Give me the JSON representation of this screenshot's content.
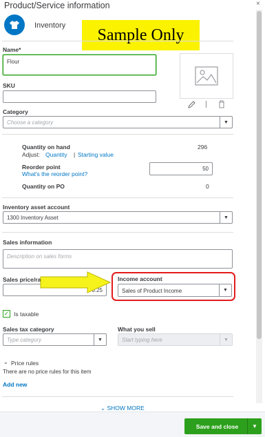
{
  "header": {
    "title": "Product/Service information",
    "close": "×",
    "type_label": "Inventory"
  },
  "banner": {
    "text": "Sample Only"
  },
  "name": {
    "label": "Name*",
    "value": "Flour"
  },
  "sku": {
    "label": "SKU",
    "value": ""
  },
  "category": {
    "label": "Category",
    "placeholder": "Choose a category"
  },
  "quantity_on_hand": {
    "label": "Quantity on hand",
    "value": "296",
    "adjust_prefix": "Adjust:",
    "adjust_quantity": "Quantity",
    "separator": "|",
    "starting_value": "Starting value"
  },
  "reorder_point": {
    "label": "Reorder point",
    "help_link": "What's the reorder point?",
    "value": "50"
  },
  "quantity_on_po": {
    "label": "Quantity on PO",
    "value": "0"
  },
  "inventory_asset_account": {
    "label": "Inventory asset account",
    "value": "1300 Inventory Asset"
  },
  "sales_information": {
    "label": "Sales information",
    "placeholder": "Description on sales forms"
  },
  "sales_price": {
    "label": "Sales price/rate",
    "value": "0.25"
  },
  "income_account": {
    "label": "Income account",
    "value": "Sales of Product Income"
  },
  "taxable": {
    "label": "Is taxable",
    "checked": true
  },
  "sales_tax_category": {
    "label": "Sales tax category",
    "placeholder": "Type category"
  },
  "what_you_sell": {
    "label": "What you sell",
    "placeholder": "Start typing here"
  },
  "price_rules": {
    "label": "Price rules",
    "empty_text": "There are no price rules for this item",
    "add_new": "Add new"
  },
  "show_more": "SHOW MORE",
  "footer": {
    "save_label": "Save and close"
  },
  "colors": {
    "accent_blue": "#0077c5",
    "save_green": "#2ca01c",
    "highlight_red": "#e21b1b",
    "arrow_yellow": "#f6f21c",
    "banner_yellow": "#fbf200"
  },
  "icons": {
    "item_type": "shirt-icon",
    "image_placeholder": "image-icon",
    "edit": "pencil-icon",
    "delete": "trash-icon"
  }
}
